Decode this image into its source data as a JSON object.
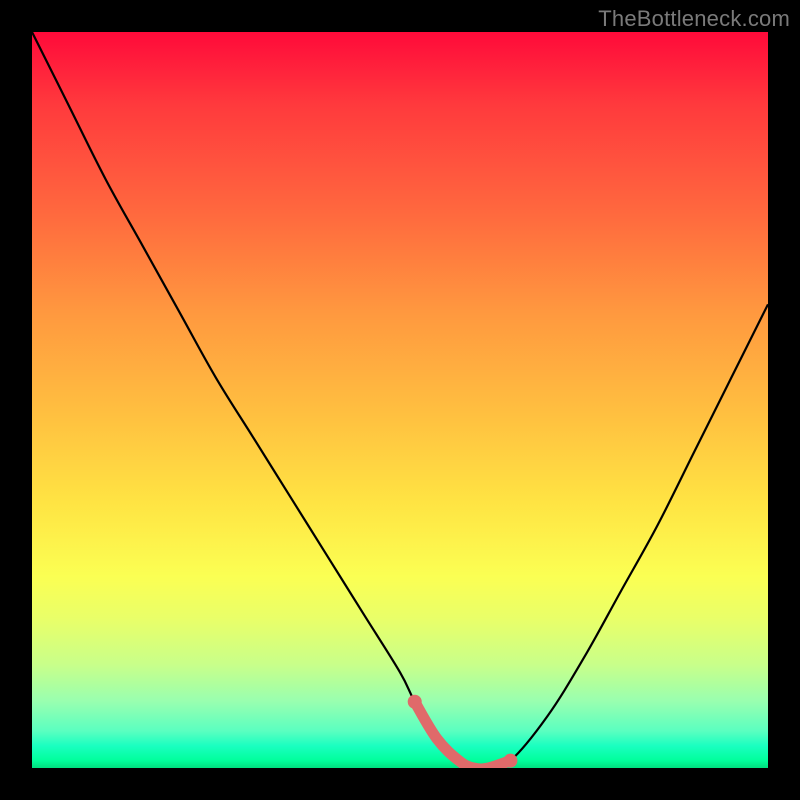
{
  "watermark": {
    "text": "TheBottleneck.com"
  },
  "colors": {
    "frame": "#000000",
    "curve": "#000000",
    "highlight": "#e06a6a",
    "gradient_top": "#ff0a3a",
    "gradient_bottom": "#00e07f"
  },
  "chart_data": {
    "type": "line",
    "title": "",
    "xlabel": "",
    "ylabel": "",
    "xlim": [
      0,
      100
    ],
    "ylim": [
      0,
      100
    ],
    "grid": false,
    "legend": false,
    "series": [
      {
        "name": "bottleneck-curve",
        "x": [
          0,
          5,
          10,
          15,
          20,
          25,
          30,
          35,
          40,
          45,
          50,
          52,
          55,
          58,
          60,
          62,
          65,
          70,
          75,
          80,
          85,
          90,
          95,
          100
        ],
        "y": [
          100,
          90,
          80,
          71,
          62,
          53,
          45,
          37,
          29,
          21,
          13,
          9,
          4,
          1,
          0,
          0,
          1,
          7,
          15,
          24,
          33,
          43,
          53,
          63
        ]
      }
    ],
    "highlight_band": {
      "name": "optimal-zone",
      "x": [
        52,
        55,
        58,
        60,
        62,
        65
      ],
      "y": [
        9,
        4,
        1,
        0,
        0,
        1
      ]
    }
  }
}
